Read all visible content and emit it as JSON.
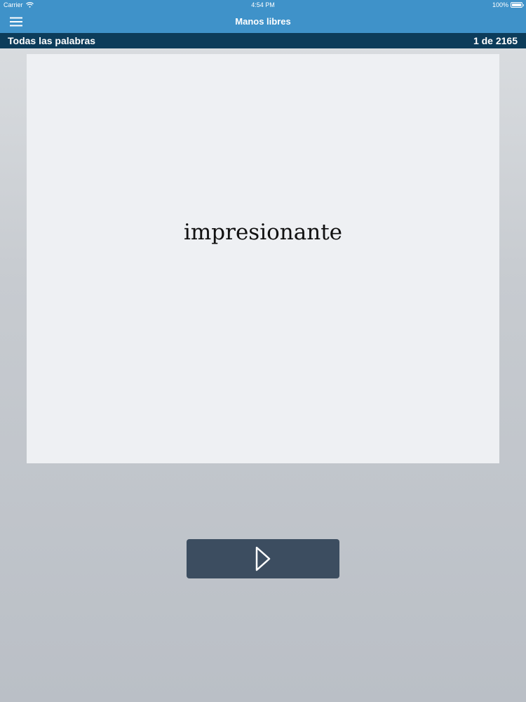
{
  "status_bar": {
    "carrier": "Carrier",
    "time": "4:54 PM",
    "battery": "100%",
    "battery_level": 1.0,
    "wifi_icon": "wifi-icon",
    "battery_icon": "battery-icon"
  },
  "nav": {
    "title": "Manos libres",
    "menu_icon": "hamburger-menu-icon"
  },
  "sub_bar": {
    "list_name": "Todas las palabras",
    "position": "1 de 2165"
  },
  "card": {
    "word": "impresionante"
  },
  "controls": {
    "play_icon": "play-icon"
  },
  "colors": {
    "accent": "#3f92c9",
    "sub_bar": "#0c3c5a",
    "button": "#3c4d60",
    "card": "#eef0f3"
  }
}
